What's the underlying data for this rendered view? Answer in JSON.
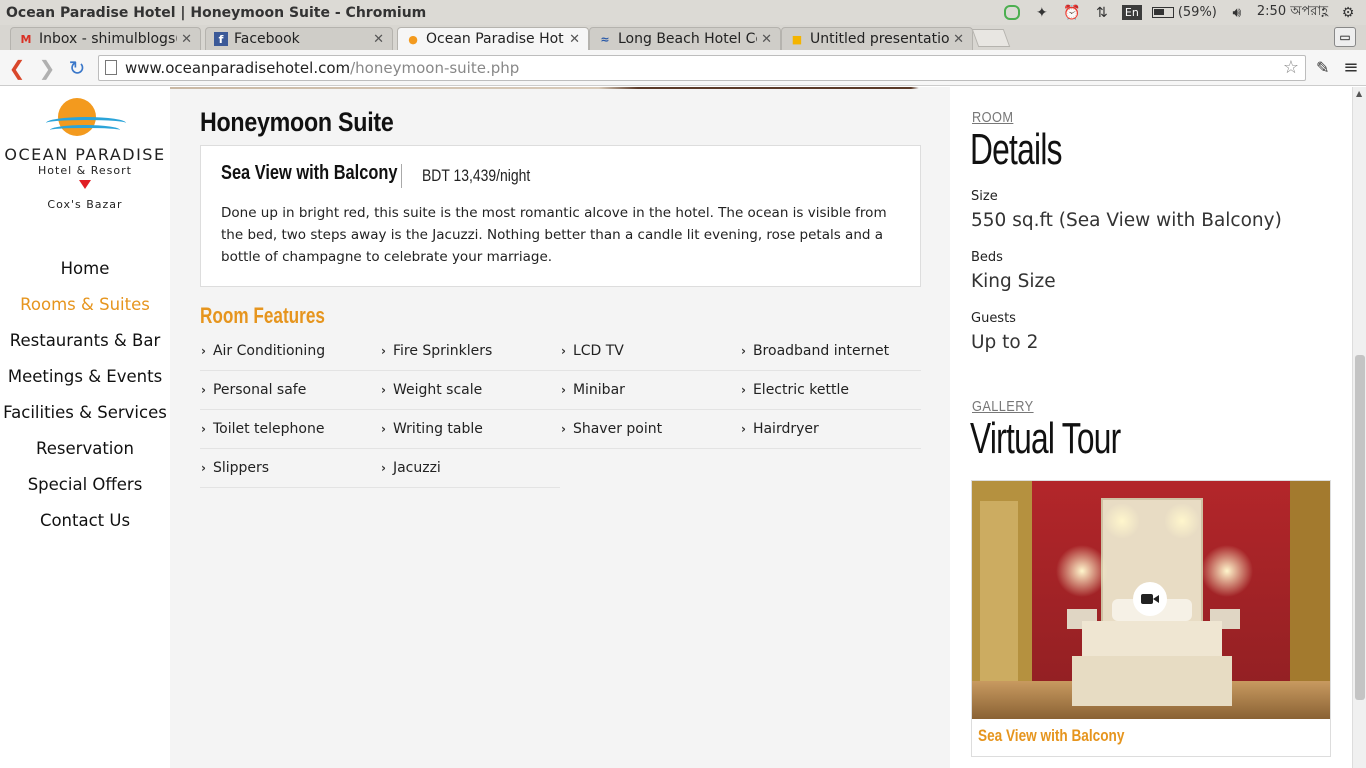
{
  "os": {
    "window_title": "Ocean Paradise Hotel | Honeymoon Suite - Chromium",
    "input_method": "En",
    "battery": "(59%)",
    "clock": "2:50 অপরাহ্ণ"
  },
  "tabs": [
    {
      "label": "Inbox - shimulblogs(",
      "favicon": "gmail-icon",
      "fav_glyph": "M"
    },
    {
      "label": "Facebook",
      "favicon": "facebook-icon",
      "fav_glyph": "f"
    },
    {
      "label": "Ocean Paradise Hot",
      "favicon": "ocean-paradise-icon",
      "fav_glyph": "●"
    },
    {
      "label": "Long Beach Hotel Co",
      "favicon": "long-beach-icon",
      "fav_glyph": "≈"
    },
    {
      "label": "Untitled presentatio",
      "favicon": "slides-icon",
      "fav_glyph": "■"
    }
  ],
  "address_bar": {
    "host": "www.oceanparadisehotel.com",
    "path": "/honeymoon-suite.php"
  },
  "logo": {
    "name": "OCEAN PARADISE",
    "sub": "Hotel & Resort",
    "place": "Cox's Bazar"
  },
  "nav": [
    {
      "label": "Home"
    },
    {
      "label": "Rooms & Suites"
    },
    {
      "label": "Restaurants & Bar"
    },
    {
      "label": "Meetings & Events"
    },
    {
      "label": "Facilities & Services"
    },
    {
      "label": "Reservation"
    },
    {
      "label": "Special Offers"
    },
    {
      "label": "Contact Us"
    }
  ],
  "main": {
    "title": "Honeymoon Suite",
    "room_type": "Sea View with Balcony",
    "price": "BDT 13,439/night",
    "description": "Done up in bright red, this suite is the most romantic alcove in the hotel. The ocean is visible from the bed, two steps away is the Jacuzzi. Nothing better than a candle lit evening, rose petals and a bottle of champagne to celebrate your marriage.",
    "features_title": "Room Features",
    "features": [
      "Air Conditioning",
      "Fire Sprinklers",
      "LCD TV",
      "Broadband internet",
      "Personal safe",
      "Weight scale",
      "Minibar",
      "Electric kettle",
      "Toilet telephone",
      "Writing table",
      "Shaver point",
      "Hairdryer",
      "Slippers",
      "Jacuzzi"
    ]
  },
  "details": {
    "kicker": "ROOM",
    "title": "Details",
    "size_label": "Size",
    "size_value": "550 sq.ft (Sea View with Balcony)",
    "beds_label": "Beds",
    "beds_value": "King Size",
    "guests_label": "Guests",
    "guests_value": "Up to 2"
  },
  "gallery": {
    "kicker": "GALLERY",
    "title": "Virtual Tour",
    "caption": "Sea View with Balcony"
  },
  "colors": {
    "accent": "#e6951e",
    "back_arrow": "#d9472b",
    "reload": "#3a77c9",
    "logo_sun": "#f39a1e",
    "logo_wave": "#2ba4d9",
    "logo_triangle": "#e01e24"
  }
}
